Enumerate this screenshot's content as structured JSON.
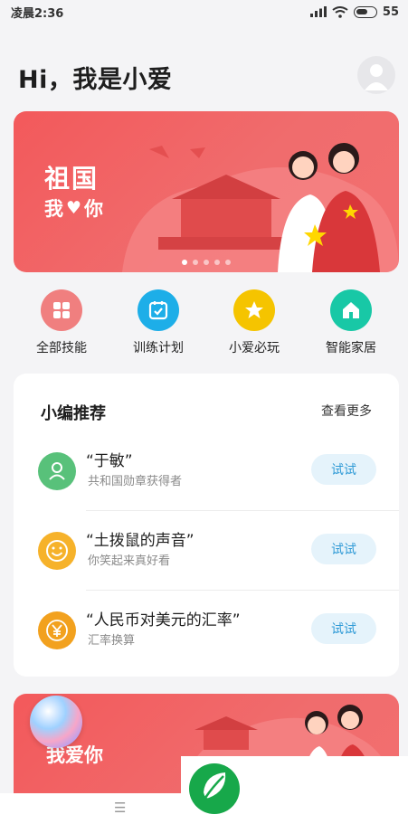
{
  "status_bar": {
    "time": "凌晨2:36",
    "battery": "55"
  },
  "greeting": "Hi，我是小爱",
  "banner": {
    "line1": "祖国",
    "line2_left": "我",
    "line2_right": "你"
  },
  "quick_actions": [
    {
      "label": "全部技能",
      "color": "#f07f7f",
      "icon": "grid-icon"
    },
    {
      "label": "训练计划",
      "color": "#1daee8",
      "icon": "calendar-check-icon"
    },
    {
      "label": "小爱必玩",
      "color": "#f5c400",
      "icon": "star-icon"
    },
    {
      "label": "智能家居",
      "color": "#18c8a6",
      "icon": "home-icon"
    }
  ],
  "recommend": {
    "title": "小编推荐",
    "more": "查看更多",
    "items": [
      {
        "title": "“于敏”",
        "subtitle": "共和国勋章获得者",
        "button": "试试",
        "icon_color": "#58c17a",
        "icon": "person-icon"
      },
      {
        "title": "“土拨鼠的声音”",
        "subtitle": "你笑起来真好看",
        "button": "试试",
        "icon_color": "#f6b22a",
        "icon": "smile-icon"
      },
      {
        "title": "“人民币对美元的汇率”",
        "subtitle": "汇率换算",
        "button": "试试",
        "icon_color": "#f2a11e",
        "icon": "currency-icon"
      }
    ]
  },
  "banner2": {
    "text": "我爱你"
  },
  "bottom": {
    "menu": "☰"
  }
}
